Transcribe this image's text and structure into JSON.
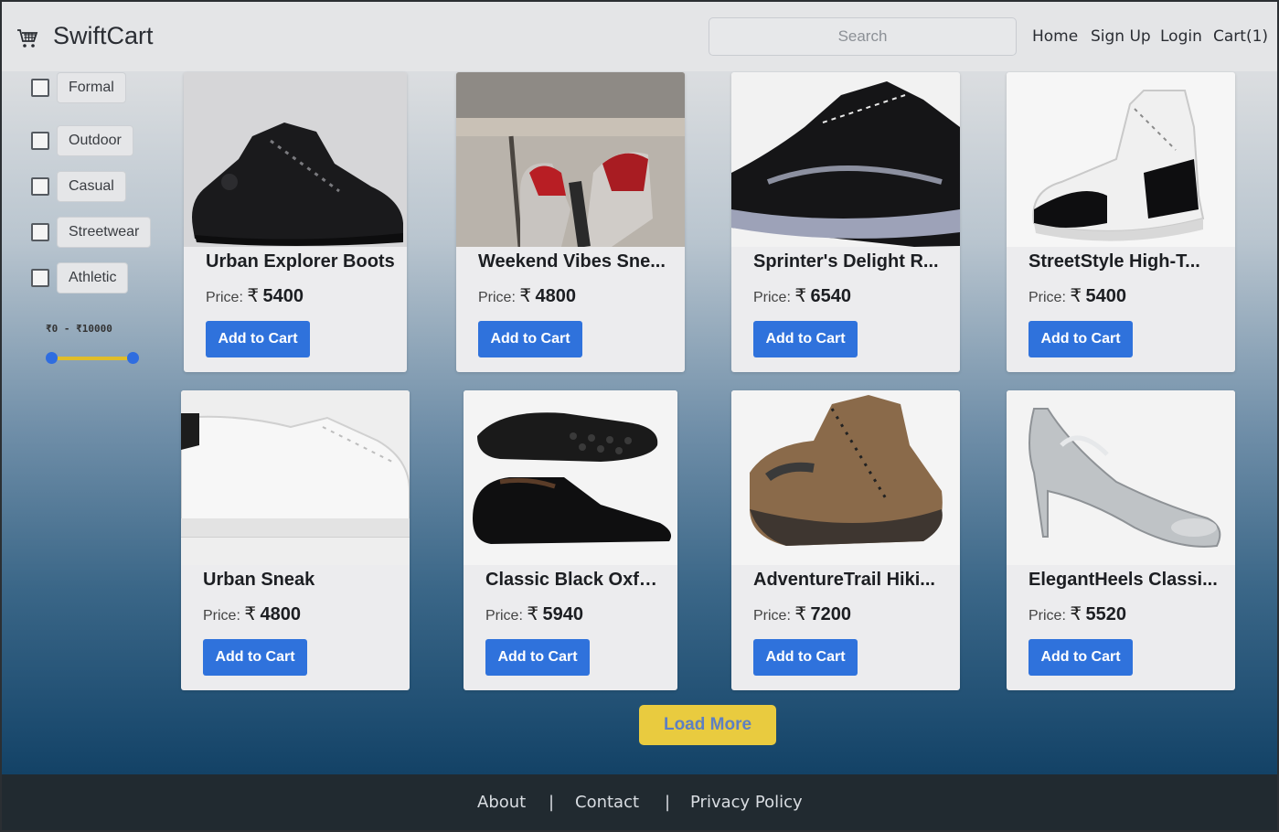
{
  "header": {
    "brand": "SwiftCart",
    "search_placeholder": "Search",
    "nav": [
      "Home",
      "Sign Up",
      "Login",
      "Cart(1)"
    ]
  },
  "sidebar": {
    "filters": [
      "Formal",
      "Outdoor",
      "Casual",
      "Streetwear",
      "Athletic"
    ],
    "price_range_label": "₹0 - ₹10000",
    "price_min": 0,
    "price_max": 10000
  },
  "products": [
    {
      "name": "Urban Explorer Boots",
      "price_label": "Price:",
      "currency": "₹",
      "price": "5400",
      "button": "Add to Cart"
    },
    {
      "name": "Weekend Vibes Sne...",
      "price_label": "Price:",
      "currency": "₹",
      "price": "4800",
      "button": "Add to Cart"
    },
    {
      "name": "Sprinter's Delight R...",
      "price_label": "Price:",
      "currency": "₹",
      "price": "6540",
      "button": "Add to Cart"
    },
    {
      "name": "StreetStyle High-T...",
      "price_label": "Price:",
      "currency": "₹",
      "price": "5400",
      "button": "Add to Cart"
    },
    {
      "name": "Urban Sneak",
      "price_label": "Price:",
      "currency": "₹",
      "price": "4800",
      "button": "Add to Cart"
    },
    {
      "name": "Classic Black Oxford",
      "price_label": "Price:",
      "currency": "₹",
      "price": "5940",
      "button": "Add to Cart"
    },
    {
      "name": "AdventureTrail Hiki...",
      "price_label": "Price:",
      "currency": "₹",
      "price": "7200",
      "button": "Add to Cart"
    },
    {
      "name": "ElegantHeels Classi...",
      "price_label": "Price:",
      "currency": "₹",
      "price": "5520",
      "button": "Add to Cart"
    }
  ],
  "load_more": "Load More",
  "footer": {
    "links": [
      "About",
      "Contact",
      "Privacy Policy"
    ],
    "separator": "|"
  }
}
